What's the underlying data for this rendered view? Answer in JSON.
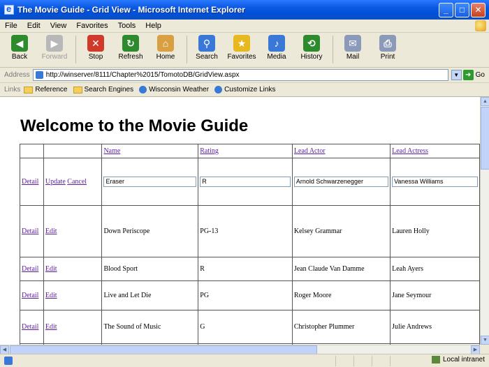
{
  "window": {
    "title": "The Movie Guide - Grid View - Microsoft Internet Explorer",
    "minimize": "_",
    "maximize": "□",
    "close": "✕"
  },
  "menu": [
    "File",
    "Edit",
    "View",
    "Favorites",
    "Tools",
    "Help"
  ],
  "toolbar": {
    "buttons": [
      {
        "label": "Back",
        "icon": "back-icon",
        "color": "#2d8a2d",
        "glyph": "◀"
      },
      {
        "label": "Forward",
        "icon": "forward-icon",
        "color": "#b8b8b8",
        "glyph": "▶"
      },
      {
        "label": "Stop",
        "icon": "stop-icon",
        "color": "#d03a2a",
        "glyph": "✕"
      },
      {
        "label": "Refresh",
        "icon": "refresh-icon",
        "color": "#2d8a2d",
        "glyph": "↻"
      },
      {
        "label": "Home",
        "icon": "home-icon",
        "color": "#d8a040",
        "glyph": "⌂"
      },
      {
        "label": "Search",
        "icon": "search-icon",
        "color": "#3a78d8",
        "glyph": "⚲"
      },
      {
        "label": "Favorites",
        "icon": "favorites-icon",
        "color": "#e8b820",
        "glyph": "★"
      },
      {
        "label": "Media",
        "icon": "media-icon",
        "color": "#3a78d8",
        "glyph": "♪"
      },
      {
        "label": "History",
        "icon": "history-icon",
        "color": "#2d8a2d",
        "glyph": "⟲"
      },
      {
        "label": "Mail",
        "icon": "mail-icon",
        "color": "#8a9ab8",
        "glyph": "✉"
      },
      {
        "label": "Print",
        "icon": "print-icon",
        "color": "#8a9ab8",
        "glyph": "⎙"
      }
    ]
  },
  "address": {
    "label": "Address",
    "url": "http://winserver/8111/Chapter%2015/TomotoDB/GridView.aspx",
    "go_label": "Go"
  },
  "links": {
    "label": "Links",
    "items": [
      "Reference",
      "Search Engines",
      "Wisconsin Weather",
      "Customize Links"
    ]
  },
  "page": {
    "title": "Welcome to the Movie Guide"
  },
  "grid": {
    "headers": [
      "",
      "",
      "Name",
      "Rating",
      "Lead Actor",
      "Lead Actress"
    ],
    "edit_row": {
      "links": [
        "Detail",
        "Update",
        "Cancel"
      ],
      "name": "Eraser",
      "rating": "R",
      "actor": "Arnold Schwarzenegger",
      "actress": "Vanessa Williams"
    },
    "rows": [
      {
        "detail": "Detail",
        "edit": "Edit",
        "name": "Down Periscope",
        "rating": "PG-13",
        "actor": "Kelsey Grammar",
        "actress": "Lauren Holly"
      },
      {
        "detail": "Detail",
        "edit": "Edit",
        "name": "Blood Sport",
        "rating": "R",
        "actor": "Jean Claude Van Damme",
        "actress": "Leah Ayers"
      },
      {
        "detail": "Detail",
        "edit": "Edit",
        "name": "Live and Let Die",
        "rating": "PG",
        "actor": "Roger Moore",
        "actress": "Jane Seymour"
      },
      {
        "detail": "Detail",
        "edit": "Edit",
        "name": "The Sound of Music",
        "rating": "G",
        "actor": "Christopher Plummer",
        "actress": "Julie Andrews"
      }
    ]
  },
  "status": {
    "zone": "Local intranet"
  }
}
